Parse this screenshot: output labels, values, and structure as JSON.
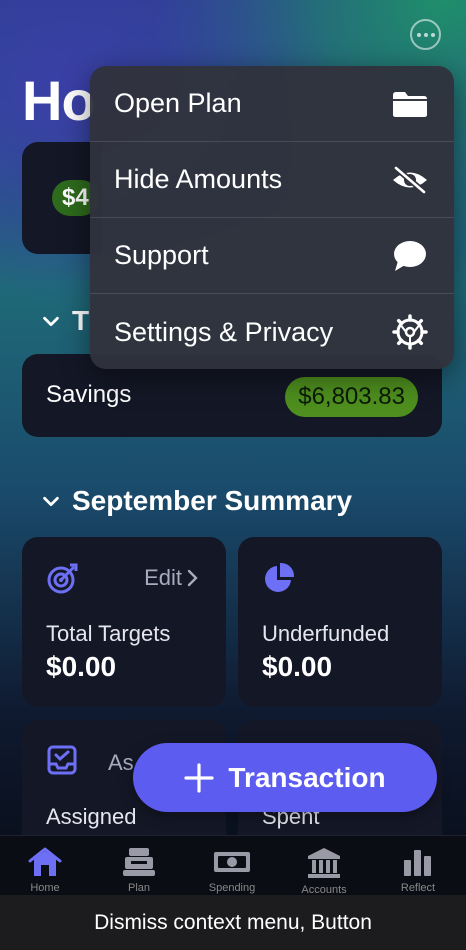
{
  "header": {
    "title": "Ho",
    "more_icon": "ellipsis-circle-icon"
  },
  "top_card": {
    "amount_partial": "$4"
  },
  "targets_section": {
    "title_partial": "T"
  },
  "savings": {
    "label": "Savings",
    "amount": "$6,803.83"
  },
  "summary": {
    "title": "September Summary",
    "tiles": [
      {
        "label": "Total Targets",
        "value": "$0.00",
        "icon": "target-icon",
        "action": "Edit"
      },
      {
        "label": "Underfunded",
        "value": "$0.00",
        "icon": "pie-chart-icon"
      },
      {
        "label": "Assigned",
        "action_partial": "As",
        "icon": "tray-check-icon"
      },
      {
        "label": "Spent",
        "icon": "none"
      }
    ]
  },
  "fab": {
    "label": "Transaction",
    "icon": "plus-icon"
  },
  "context_menu": {
    "items": [
      {
        "label": "Open Plan",
        "icon": "folder-icon"
      },
      {
        "label": "Hide Amounts",
        "icon": "eye-slash-icon"
      },
      {
        "label": "Support",
        "icon": "chat-bubble-icon"
      },
      {
        "label": "Settings & Privacy",
        "icon": "gear-icon"
      }
    ]
  },
  "tab_bar": {
    "items": [
      {
        "label": "Home",
        "icon": "house-icon",
        "active": true
      },
      {
        "label": "Plan",
        "icon": "register-icon"
      },
      {
        "label": "Spending",
        "icon": "banknote-icon"
      },
      {
        "label": "Accounts",
        "icon": "bank-icon"
      },
      {
        "label": "Reflect",
        "icon": "bar-chart-icon"
      }
    ]
  },
  "accessibility_tooltip": {
    "text": "Dismiss context menu, Button"
  },
  "colors": {
    "accent": "#5c5cf0",
    "positive_pill": "#4e8f1f",
    "card_bg": "#141726"
  }
}
